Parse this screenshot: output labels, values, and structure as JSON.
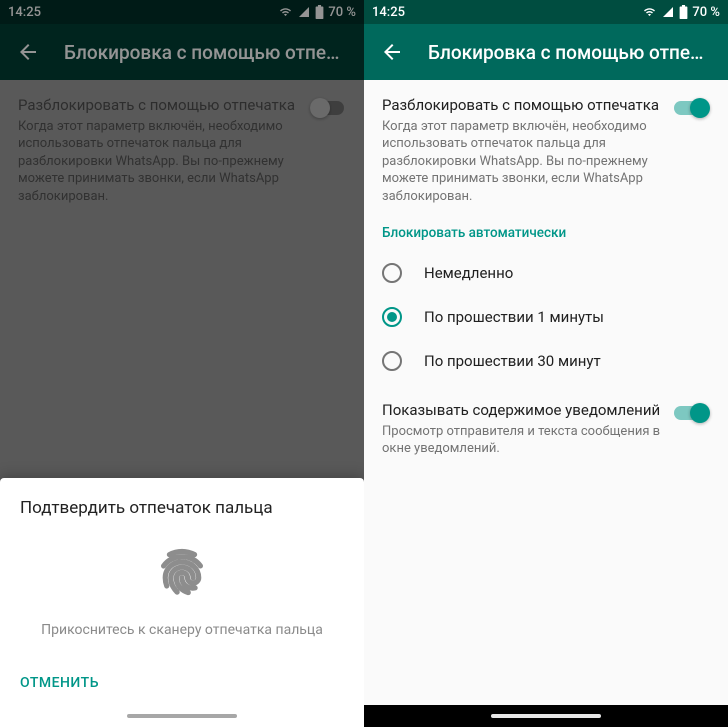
{
  "statusbar": {
    "time": "14:25",
    "battery": "70 %"
  },
  "appbar": {
    "title": "Блокировка с помощью отпе…"
  },
  "unlock": {
    "title": "Разблокировать с помощью отпечатка",
    "desc": "Когда этот параметр включён, необходимо использовать отпечаток пальца для разблокировки WhatsApp. Вы по-прежнему можете принимать звонки, если WhatsApp заблокирован."
  },
  "auto_lock": {
    "header": "Блокировать автоматически",
    "options": {
      "immediate": "Немедленно",
      "one_min": "По прошествии 1 минуты",
      "thirty_min": "По прошествии 30 минут"
    }
  },
  "notif": {
    "title": "Показывать содержимое уведомлений",
    "desc": "Просмотр отправителя и текста сообщения в окне уведомлений."
  },
  "sheet": {
    "title": "Подтвердить отпечаток пальца",
    "hint": "Прикоснитесь к сканеру отпечатка пальца",
    "cancel": "ОТМЕНИТЬ"
  }
}
